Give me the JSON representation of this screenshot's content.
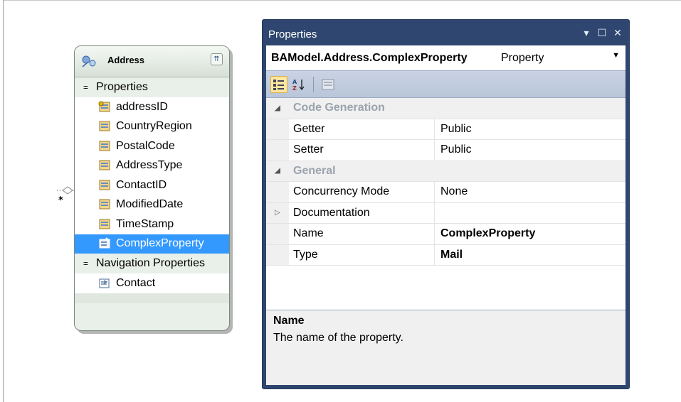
{
  "entity": {
    "title": "Address",
    "sections": [
      {
        "label": "Properties",
        "items": [
          {
            "label": "addressID",
            "icon": "key-property-icon"
          },
          {
            "label": "CountryRegion",
            "icon": "property-icon"
          },
          {
            "label": "PostalCode",
            "icon": "property-icon"
          },
          {
            "label": "AddressType",
            "icon": "property-icon"
          },
          {
            "label": "ContactID",
            "icon": "property-icon"
          },
          {
            "label": "ModifiedDate",
            "icon": "property-icon"
          },
          {
            "label": "TimeStamp",
            "icon": "property-icon"
          },
          {
            "label": "ComplexProperty",
            "icon": "complex-property-icon",
            "selected": true
          }
        ]
      },
      {
        "label": "Navigation Properties",
        "items": [
          {
            "label": "Contact",
            "icon": "navigation-property-icon"
          }
        ]
      }
    ]
  },
  "connector": {
    "multiplicity": "*"
  },
  "properties_window": {
    "title": "Properties",
    "selector": {
      "object": "BAModel.Address.ComplexProperty",
      "kind": "Property"
    },
    "categories": [
      {
        "label": "Code Generation",
        "rows": [
          {
            "name": "Getter",
            "value": "Public",
            "bold": false,
            "expandable": false
          },
          {
            "name": "Setter",
            "value": "Public",
            "bold": false,
            "expandable": false
          }
        ]
      },
      {
        "label": "General",
        "rows": [
          {
            "name": "Concurrency Mode",
            "value": "None",
            "bold": false,
            "expandable": false
          },
          {
            "name": "Documentation",
            "value": "",
            "bold": false,
            "expandable": true
          },
          {
            "name": "Name",
            "value": "ComplexProperty",
            "bold": true,
            "expandable": false
          },
          {
            "name": "Type",
            "value": "Mail",
            "bold": true,
            "expandable": false
          }
        ]
      }
    ],
    "description": {
      "title": "Name",
      "text": "The name of the property."
    }
  },
  "colors": {
    "selection": "#3399ff",
    "window_frame": "#2f4770",
    "category_text": "#9aa3ad"
  }
}
